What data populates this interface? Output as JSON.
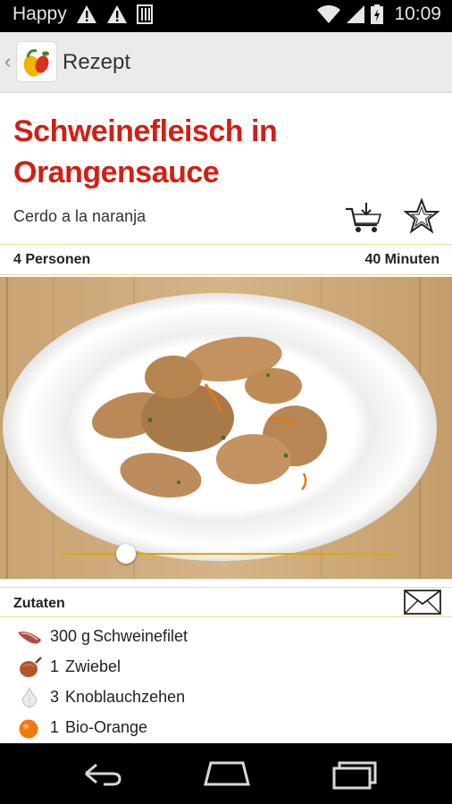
{
  "status_bar": {
    "carrier": "Happy",
    "time": "10:09"
  },
  "action_bar": {
    "title": "Rezept"
  },
  "recipe": {
    "title": "Schweinefleisch in Orangensauce",
    "subtitle": "Cerdo a la naranja",
    "servings": "4 Personen",
    "duration": "40 Minuten"
  },
  "ingredients": {
    "header": "Zutaten",
    "items": [
      {
        "qty": "300 g",
        "name": "Schweinefilet",
        "icon": "pork-fillet-icon"
      },
      {
        "qty": "1",
        "name": "Zwiebel",
        "icon": "onion-icon"
      },
      {
        "qty": "3",
        "name": "Knoblauchzehen",
        "icon": "garlic-icon"
      },
      {
        "qty": "1",
        "name": "Bio-Orange",
        "icon": "orange-icon"
      }
    ]
  },
  "photo_slider": {
    "position": 0.2
  },
  "colors": {
    "accent_red": "#d21f14",
    "accent_gold": "#e0a800"
  }
}
